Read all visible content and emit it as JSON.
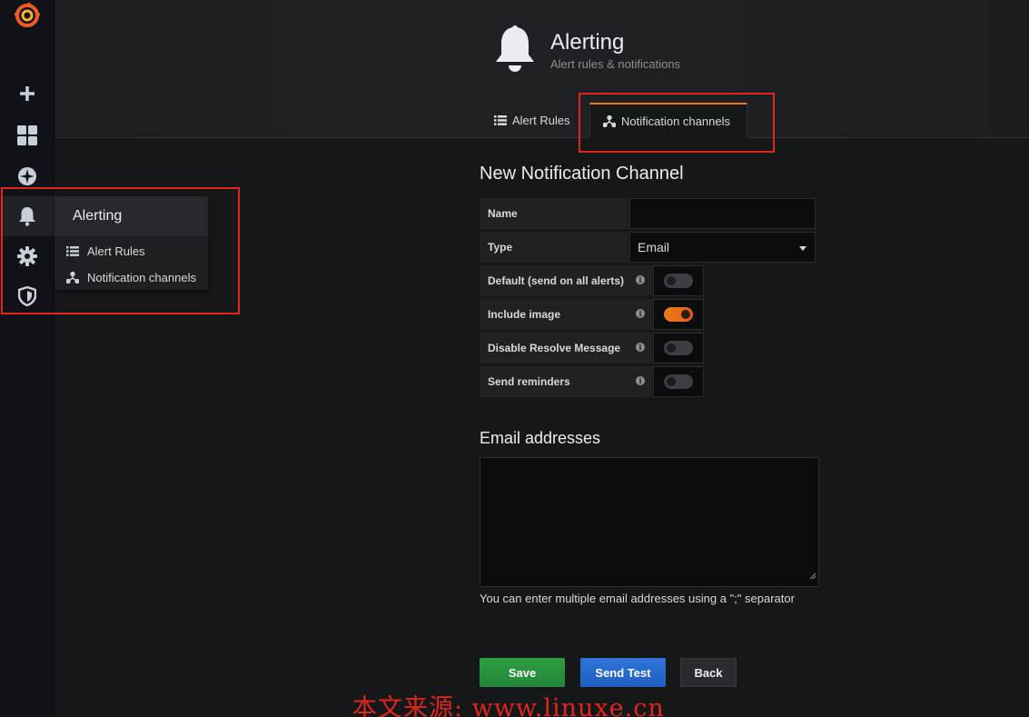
{
  "sidebar": {
    "items": [
      {
        "name": "grafana-logo-icon"
      },
      {
        "name": "plus-icon"
      },
      {
        "name": "dashboards-icon"
      },
      {
        "name": "explore-compass-icon"
      },
      {
        "name": "bell-icon"
      },
      {
        "name": "gear-icon"
      },
      {
        "name": "shield-icon"
      }
    ],
    "flyout": {
      "title": "Alerting",
      "items": [
        {
          "label": "Alert Rules",
          "icon": "list-icon"
        },
        {
          "label": "Notification channels",
          "icon": "share-nodes-icon"
        }
      ]
    }
  },
  "header": {
    "title": "Alerting",
    "subtitle": "Alert rules & notifications",
    "tabs": [
      {
        "label": "Alert Rules",
        "icon": "list-icon",
        "active": false
      },
      {
        "label": "Notification channels",
        "icon": "share-nodes-icon",
        "active": true
      }
    ]
  },
  "form": {
    "title": "New Notification Channel",
    "name_label": "Name",
    "name_value": "",
    "type_label": "Type",
    "type_value": "Email",
    "toggles": [
      {
        "label": "Default (send on all alerts)",
        "on": false
      },
      {
        "label": "Include image",
        "on": true
      },
      {
        "label": "Disable Resolve Message",
        "on": false
      },
      {
        "label": "Send reminders",
        "on": false
      }
    ],
    "email_title": "Email addresses",
    "email_value": "",
    "help_text": "You can enter multiple email addresses using a \";\" separator",
    "buttons": {
      "save": "Save",
      "send_test": "Send Test",
      "back": "Back"
    }
  },
  "colors": {
    "accent": "#eb7b18",
    "save": "#23873a",
    "send_test": "#1f5fc0",
    "highlight_box": "#e0261c"
  },
  "watermark": "本文来源: www.linuxe.cn"
}
